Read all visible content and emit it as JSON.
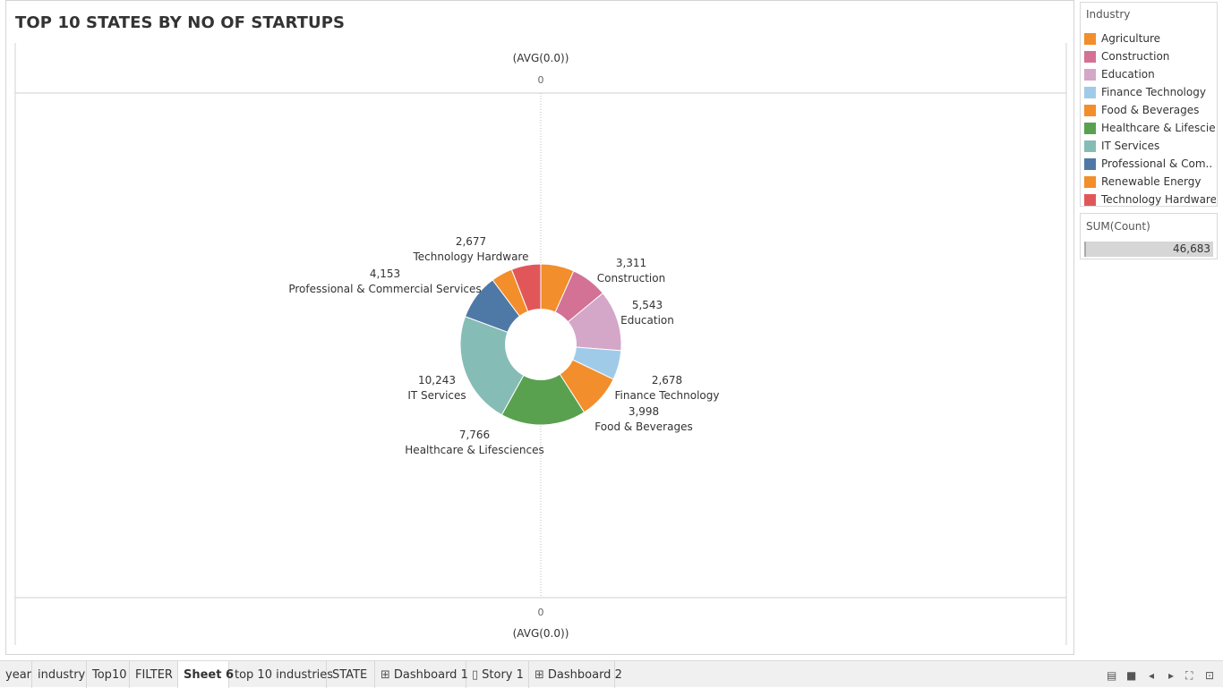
{
  "title": "TOP 10 STATES BY NO OF STARTUPS",
  "axis": {
    "top_label": "(AVG(0.0))",
    "top_tick": "0",
    "bottom_tick": "0",
    "bottom_label": "(AVG(0.0))"
  },
  "legend": {
    "title": "Industry",
    "items": [
      {
        "label": "Agriculture",
        "color": "#f28e2b"
      },
      {
        "label": "Construction",
        "color": "#d37295"
      },
      {
        "label": "Education",
        "color": "#d4a6c8"
      },
      {
        "label": "Finance Technology",
        "color": "#a0cbe8"
      },
      {
        "label": "Food & Beverages",
        "color": "#f28e2b"
      },
      {
        "label": "Healthcare & Lifescie..",
        "color": "#59a14f"
      },
      {
        "label": "IT Services",
        "color": "#86bcb6"
      },
      {
        "label": "Professional & Com..",
        "color": "#4e79a7"
      },
      {
        "label": "Renewable Energy",
        "color": "#f28e2b"
      },
      {
        "label": "Technology Hardware",
        "color": "#e15759"
      }
    ]
  },
  "size_legend": {
    "title": "SUM(Count)",
    "value": "46,683"
  },
  "chart_data": {
    "type": "pie",
    "series_field": "Industry",
    "measure": "SUM(Count)",
    "slices": [
      {
        "name": "Agriculture",
        "value": 3040,
        "color": "#f28e2b",
        "show_label": false
      },
      {
        "name": "Construction",
        "value": 3311,
        "value_label": "3,311",
        "color": "#d37295",
        "show_label": true
      },
      {
        "name": "Education",
        "value": 5543,
        "value_label": "5,543",
        "color": "#d4a6c8",
        "show_label": true
      },
      {
        "name": "Finance Technology",
        "value": 2678,
        "value_label": "2,678",
        "color": "#a0cbe8",
        "show_label": true
      },
      {
        "name": "Food & Beverages",
        "value": 3998,
        "value_label": "3,998",
        "color": "#f28e2b",
        "show_label": true
      },
      {
        "name": "Healthcare & Lifesciences",
        "value": 7766,
        "value_label": "7,766",
        "color": "#59a14f",
        "show_label": true
      },
      {
        "name": "IT Services",
        "value": 10243,
        "value_label": "10,243",
        "color": "#86bcb6",
        "show_label": true
      },
      {
        "name": "Professional & Commercial Services",
        "value": 4153,
        "value_label": "4,153",
        "color": "#4e79a7",
        "show_label": true
      },
      {
        "name": "Renewable Energy",
        "value": 1950,
        "color": "#f28e2b",
        "show_label": false
      },
      {
        "name": "Technology Hardware",
        "value": 2677,
        "value_label": "2,677",
        "color": "#e15759",
        "show_label": true
      }
    ],
    "ylim": [
      0,
      0
    ]
  },
  "tabs": [
    {
      "label": "year",
      "icon": "",
      "active": false
    },
    {
      "label": "industry",
      "icon": "",
      "active": false
    },
    {
      "label": "Top10",
      "icon": "",
      "active": false
    },
    {
      "label": "FILTER",
      "icon": "",
      "active": false
    },
    {
      "label": "Sheet 6",
      "icon": "",
      "active": true
    },
    {
      "label": "top 10 industries",
      "icon": "",
      "active": false
    },
    {
      "label": "STATE",
      "icon": "",
      "active": false
    },
    {
      "label": "Dashboard 1",
      "icon": "dashboard-icon",
      "active": false
    },
    {
      "label": "Story 1",
      "icon": "story-icon",
      "active": false
    },
    {
      "label": "Dashboard 2",
      "icon": "dashboard-icon",
      "active": false
    }
  ],
  "nav_icons": [
    "show-sheet-sorter-icon",
    "show-filmstrip-icon",
    "previous-sheet-icon",
    "next-sheet-icon",
    "fullscreen-icon",
    "presentation-mode-icon"
  ]
}
